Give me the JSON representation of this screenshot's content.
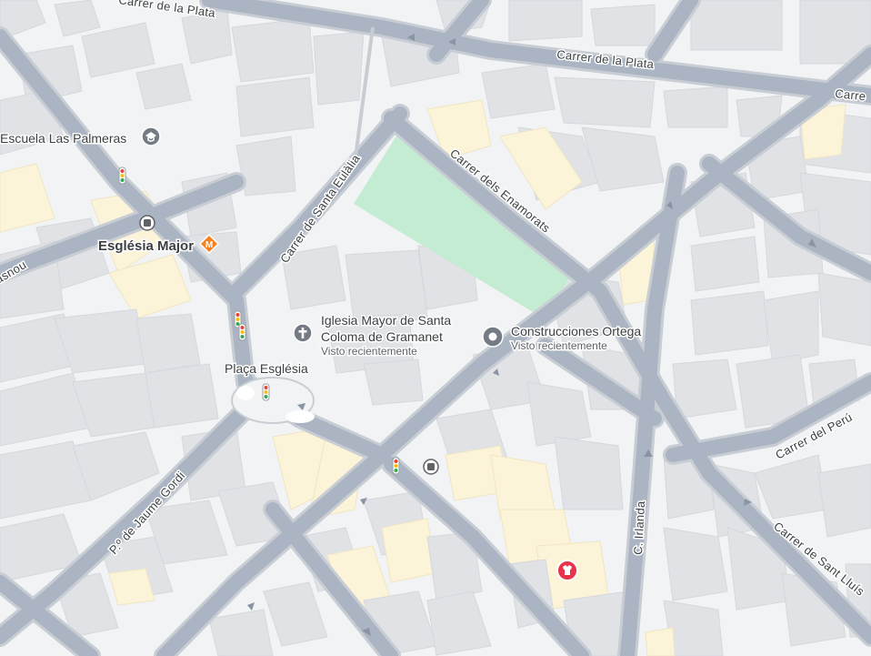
{
  "streets": {
    "plata_top": "Carrer de la Plata",
    "plata": "Carrer de la Plata",
    "carrer_right": "Carre",
    "santa_eulalia": "Carrer de Santa Eulàlia",
    "enamorats": "Carrer dels Enamorats",
    "jaume_gordi": "P.º de Jaume Gordi",
    "irlanda": "C. Irlanda",
    "peru": "Carrer del Perú",
    "sant_lluis": "Carrer de Sant Lluís",
    "asnou": "asnou"
  },
  "pois": {
    "escuela": {
      "name": "Escuela Las Palmeras",
      "icon": "school-icon"
    },
    "esglesia_major": {
      "name": "Església Major",
      "icons": [
        "bus-icon",
        "metro-icon"
      ]
    },
    "iglesia": {
      "line1": "Iglesia Mayor de Santa",
      "line2": "Coloma de Gramanet",
      "sub": "Visto recientemente",
      "icon": "church-icon"
    },
    "construcciones": {
      "name": "Construcciones Ortega",
      "sub": "Visto recientemente",
      "icon": "pin-icon"
    },
    "placa": {
      "name": "Plaça Església"
    },
    "bus_stop": {
      "icon": "bus-icon"
    },
    "shop": {
      "icon": "shop-icon"
    }
  },
  "colors": {
    "background": "#f1f3f4",
    "road": "#aab4c3",
    "park": "#c3ecd2",
    "building": "#e0e2e6",
    "highlight_building": "#fcf4d9",
    "metro": "#f5821f",
    "shop": "#e8334a",
    "poi_gray": "#757b84"
  }
}
